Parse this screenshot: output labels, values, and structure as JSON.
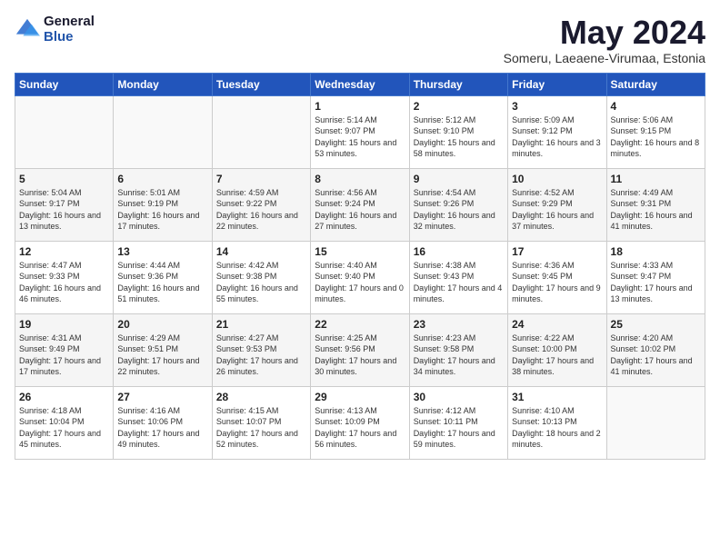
{
  "logo": {
    "general": "General",
    "blue": "Blue"
  },
  "title": {
    "month_year": "May 2024",
    "location": "Someru, Laeaene-Virumaa, Estonia"
  },
  "days_of_week": [
    "Sunday",
    "Monday",
    "Tuesday",
    "Wednesday",
    "Thursday",
    "Friday",
    "Saturday"
  ],
  "weeks": [
    [
      {
        "day": "",
        "sunrise": "",
        "sunset": "",
        "daylight": ""
      },
      {
        "day": "",
        "sunrise": "",
        "sunset": "",
        "daylight": ""
      },
      {
        "day": "",
        "sunrise": "",
        "sunset": "",
        "daylight": ""
      },
      {
        "day": "1",
        "sunrise": "Sunrise: 5:14 AM",
        "sunset": "Sunset: 9:07 PM",
        "daylight": "Daylight: 15 hours and 53 minutes."
      },
      {
        "day": "2",
        "sunrise": "Sunrise: 5:12 AM",
        "sunset": "Sunset: 9:10 PM",
        "daylight": "Daylight: 15 hours and 58 minutes."
      },
      {
        "day": "3",
        "sunrise": "Sunrise: 5:09 AM",
        "sunset": "Sunset: 9:12 PM",
        "daylight": "Daylight: 16 hours and 3 minutes."
      },
      {
        "day": "4",
        "sunrise": "Sunrise: 5:06 AM",
        "sunset": "Sunset: 9:15 PM",
        "daylight": "Daylight: 16 hours and 8 minutes."
      }
    ],
    [
      {
        "day": "5",
        "sunrise": "Sunrise: 5:04 AM",
        "sunset": "Sunset: 9:17 PM",
        "daylight": "Daylight: 16 hours and 13 minutes."
      },
      {
        "day": "6",
        "sunrise": "Sunrise: 5:01 AM",
        "sunset": "Sunset: 9:19 PM",
        "daylight": "Daylight: 16 hours and 17 minutes."
      },
      {
        "day": "7",
        "sunrise": "Sunrise: 4:59 AM",
        "sunset": "Sunset: 9:22 PM",
        "daylight": "Daylight: 16 hours and 22 minutes."
      },
      {
        "day": "8",
        "sunrise": "Sunrise: 4:56 AM",
        "sunset": "Sunset: 9:24 PM",
        "daylight": "Daylight: 16 hours and 27 minutes."
      },
      {
        "day": "9",
        "sunrise": "Sunrise: 4:54 AM",
        "sunset": "Sunset: 9:26 PM",
        "daylight": "Daylight: 16 hours and 32 minutes."
      },
      {
        "day": "10",
        "sunrise": "Sunrise: 4:52 AM",
        "sunset": "Sunset: 9:29 PM",
        "daylight": "Daylight: 16 hours and 37 minutes."
      },
      {
        "day": "11",
        "sunrise": "Sunrise: 4:49 AM",
        "sunset": "Sunset: 9:31 PM",
        "daylight": "Daylight: 16 hours and 41 minutes."
      }
    ],
    [
      {
        "day": "12",
        "sunrise": "Sunrise: 4:47 AM",
        "sunset": "Sunset: 9:33 PM",
        "daylight": "Daylight: 16 hours and 46 minutes."
      },
      {
        "day": "13",
        "sunrise": "Sunrise: 4:44 AM",
        "sunset": "Sunset: 9:36 PM",
        "daylight": "Daylight: 16 hours and 51 minutes."
      },
      {
        "day": "14",
        "sunrise": "Sunrise: 4:42 AM",
        "sunset": "Sunset: 9:38 PM",
        "daylight": "Daylight: 16 hours and 55 minutes."
      },
      {
        "day": "15",
        "sunrise": "Sunrise: 4:40 AM",
        "sunset": "Sunset: 9:40 PM",
        "daylight": "Daylight: 17 hours and 0 minutes."
      },
      {
        "day": "16",
        "sunrise": "Sunrise: 4:38 AM",
        "sunset": "Sunset: 9:43 PM",
        "daylight": "Daylight: 17 hours and 4 minutes."
      },
      {
        "day": "17",
        "sunrise": "Sunrise: 4:36 AM",
        "sunset": "Sunset: 9:45 PM",
        "daylight": "Daylight: 17 hours and 9 minutes."
      },
      {
        "day": "18",
        "sunrise": "Sunrise: 4:33 AM",
        "sunset": "Sunset: 9:47 PM",
        "daylight": "Daylight: 17 hours and 13 minutes."
      }
    ],
    [
      {
        "day": "19",
        "sunrise": "Sunrise: 4:31 AM",
        "sunset": "Sunset: 9:49 PM",
        "daylight": "Daylight: 17 hours and 17 minutes."
      },
      {
        "day": "20",
        "sunrise": "Sunrise: 4:29 AM",
        "sunset": "Sunset: 9:51 PM",
        "daylight": "Daylight: 17 hours and 22 minutes."
      },
      {
        "day": "21",
        "sunrise": "Sunrise: 4:27 AM",
        "sunset": "Sunset: 9:53 PM",
        "daylight": "Daylight: 17 hours and 26 minutes."
      },
      {
        "day": "22",
        "sunrise": "Sunrise: 4:25 AM",
        "sunset": "Sunset: 9:56 PM",
        "daylight": "Daylight: 17 hours and 30 minutes."
      },
      {
        "day": "23",
        "sunrise": "Sunrise: 4:23 AM",
        "sunset": "Sunset: 9:58 PM",
        "daylight": "Daylight: 17 hours and 34 minutes."
      },
      {
        "day": "24",
        "sunrise": "Sunrise: 4:22 AM",
        "sunset": "Sunset: 10:00 PM",
        "daylight": "Daylight: 17 hours and 38 minutes."
      },
      {
        "day": "25",
        "sunrise": "Sunrise: 4:20 AM",
        "sunset": "Sunset: 10:02 PM",
        "daylight": "Daylight: 17 hours and 41 minutes."
      }
    ],
    [
      {
        "day": "26",
        "sunrise": "Sunrise: 4:18 AM",
        "sunset": "Sunset: 10:04 PM",
        "daylight": "Daylight: 17 hours and 45 minutes."
      },
      {
        "day": "27",
        "sunrise": "Sunrise: 4:16 AM",
        "sunset": "Sunset: 10:06 PM",
        "daylight": "Daylight: 17 hours and 49 minutes."
      },
      {
        "day": "28",
        "sunrise": "Sunrise: 4:15 AM",
        "sunset": "Sunset: 10:07 PM",
        "daylight": "Daylight: 17 hours and 52 minutes."
      },
      {
        "day": "29",
        "sunrise": "Sunrise: 4:13 AM",
        "sunset": "Sunset: 10:09 PM",
        "daylight": "Daylight: 17 hours and 56 minutes."
      },
      {
        "day": "30",
        "sunrise": "Sunrise: 4:12 AM",
        "sunset": "Sunset: 10:11 PM",
        "daylight": "Daylight: 17 hours and 59 minutes."
      },
      {
        "day": "31",
        "sunrise": "Sunrise: 4:10 AM",
        "sunset": "Sunset: 10:13 PM",
        "daylight": "Daylight: 18 hours and 2 minutes."
      },
      {
        "day": "",
        "sunrise": "",
        "sunset": "",
        "daylight": ""
      }
    ]
  ]
}
